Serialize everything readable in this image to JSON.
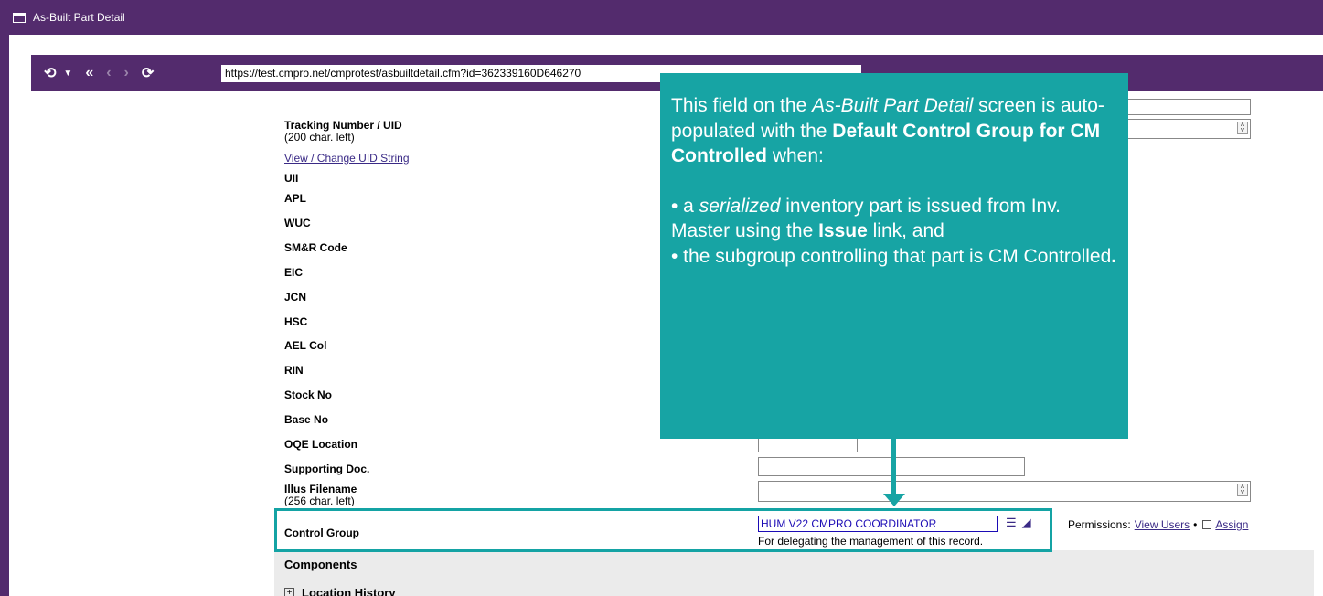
{
  "window": {
    "title": "As-Built Part Detail"
  },
  "nav": {
    "url": "https://test.cmpro.net/cmprotest/asbuiltdetail.cfm?id=362339160D646270"
  },
  "form": {
    "tracking_label": "Tracking Number / UID",
    "tracking_chars_left": "(200 char. left)",
    "view_change_uid": "View / Change UID String",
    "fields": [
      "UII",
      "APL",
      "WUC",
      "SM&R Code",
      "EIC",
      "JCN",
      "HSC",
      "AEL Col",
      "RIN",
      "Stock No",
      "Base No",
      "OQE Location",
      "Supporting Doc."
    ],
    "illus_label": "Illus Filename",
    "illus_chars_left": "(256 char. left)",
    "control_group_label": "Control Group",
    "control_group_value": "HUM V22 CMPRO COORDINATOR",
    "control_group_hint": "For delegating the management of this record.",
    "permissions_label": "Permissions:",
    "view_users": "View Users",
    "separator": "•",
    "assign": "Assign",
    "components": "Components",
    "location_history": "Location History"
  },
  "callout": {
    "line1_pre": "This field on the ",
    "line1_em": "As-Built Part Detail",
    "line1_post": " screen is auto-populated with the ",
    "line1_bold": "Default Control Group for CM Controlled",
    "line1_end": " when:",
    "b1_pre": "• a ",
    "b1_em": "serialized",
    "b1_post": " inventory part is issued from Inv. Master using the ",
    "b1_bold": "Issue",
    "b1_end": " link, and",
    "b2_pre": "• the subgroup controlling that part is CM Controlled",
    "b2_end": "."
  }
}
